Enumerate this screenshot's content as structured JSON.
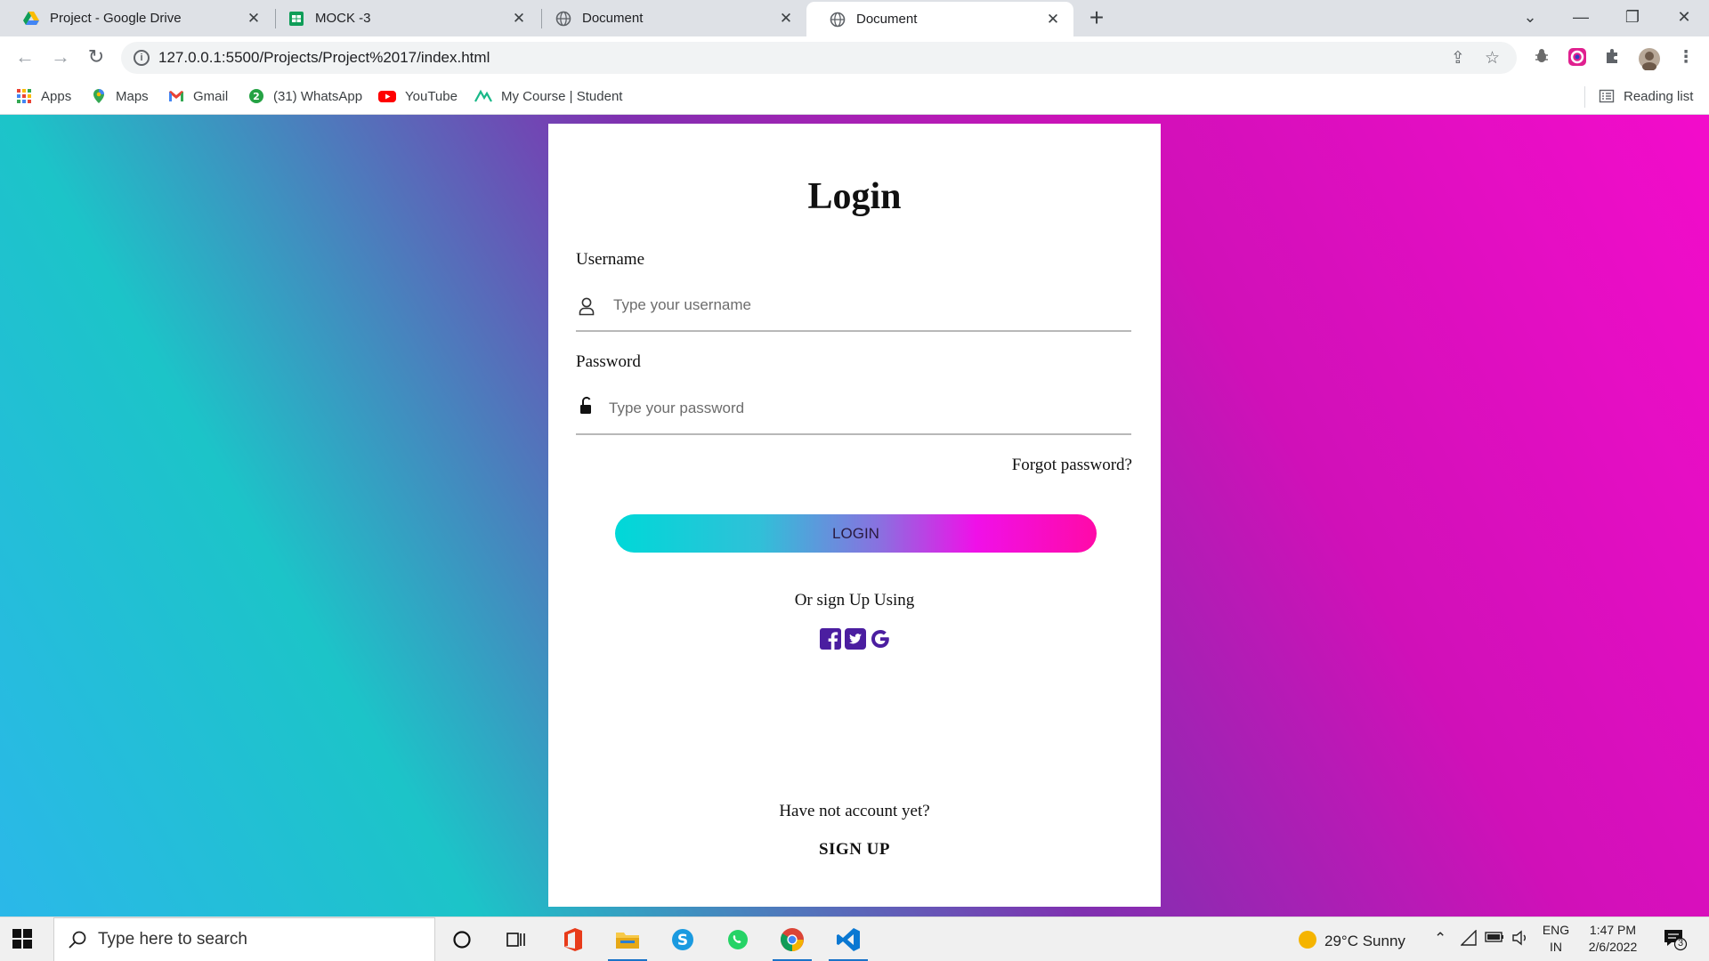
{
  "browser": {
    "tabs": [
      {
        "title": "Project - Google Drive",
        "icon": "google-drive-icon",
        "active": false
      },
      {
        "title": "MOCK -3",
        "icon": "google-sheets-icon",
        "active": false
      },
      {
        "title": "Document",
        "icon": "globe-icon",
        "active": false
      },
      {
        "title": "Document",
        "icon": "globe-icon",
        "active": true
      }
    ],
    "close_glyph": "✕",
    "new_tab_glyph": "+",
    "window_controls": {
      "dropdown": "⌄",
      "minimize": "—",
      "restore": "❐",
      "close": "✕"
    },
    "url": "127.0.0.1:5500/Projects/Project%2017/index.html",
    "bookmarks": [
      {
        "label": "Apps",
        "icon": "apps-grid-icon"
      },
      {
        "label": "Maps",
        "icon": "maps-pin-icon"
      },
      {
        "label": "Gmail",
        "icon": "gmail-icon"
      },
      {
        "label": "(31) WhatsApp",
        "icon": "whatsapp-icon"
      },
      {
        "label": "YouTube",
        "icon": "youtube-icon"
      },
      {
        "label": "My Course | Student",
        "icon": "course-icon"
      }
    ],
    "reading_list": "Reading list"
  },
  "login": {
    "title": "Login",
    "username_label": "Username",
    "username_placeholder": "Type your username",
    "password_label": "Password",
    "password_placeholder": "Type your password",
    "forgot": "Forgot password?",
    "login_button": "LOGIN",
    "or_sign_up": "Or sign Up Using",
    "no_account": "Have not account yet?",
    "sign_up": "SIGN UP",
    "social_icons": [
      "facebook-icon",
      "twitter-icon",
      "google-icon"
    ]
  },
  "taskbar": {
    "search_placeholder": "Type here to search",
    "weather": "29°C  Sunny",
    "lang_line1": "ENG",
    "lang_line2": "IN",
    "time": "1:47 PM",
    "date": "2/6/2022",
    "notification_count": "3"
  },
  "colors": {
    "gradient_start": "#2bb8e9",
    "gradient_end": "#f30ccb",
    "social_purple": "#4b1ea0"
  }
}
